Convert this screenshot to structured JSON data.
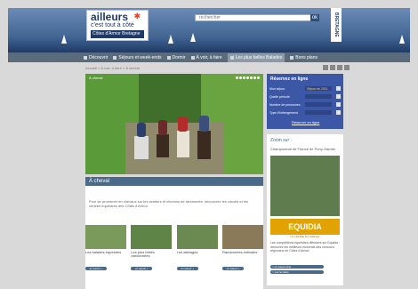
{
  "header": {
    "logo_line1": "ailleurs",
    "logo_line2": "c'est tout à côté",
    "logo_line3": "Côtes d'Armor Bretagne",
    "search_placeholder": "rechercher",
    "search_button": "ok",
    "side_label": "BRETAGNE"
  },
  "nav": {
    "items": [
      {
        "label": "Découvrir"
      },
      {
        "label": "Séjours et week-ends"
      },
      {
        "label": "Dormir"
      },
      {
        "label": "À voir, à faire"
      },
      {
        "label": "Les plus belles Balades"
      },
      {
        "label": "Bons plans"
      }
    ]
  },
  "breadcrumb": "Accueil > À voir, à faire > À cheval",
  "hero": {
    "title": "À cheval"
  },
  "section": {
    "title": "À cheval",
    "text": "Pour se promener en chevaux sur les sentiers et chemins de randonnée, découvrez les circuits et les centres équestres des Côtes d'Armor."
  },
  "thumbs": [
    {
      "caption": "Les balades équestres",
      "more": "en savoir +"
    },
    {
      "caption": "Les plus belles randonnées",
      "more": "en savoir +"
    },
    {
      "caption": "Les attelages",
      "more": "en savoir +"
    },
    {
      "caption": "Randonnées estivales",
      "more": "en savoir +"
    }
  ],
  "booking": {
    "title": "Réservez en ligne",
    "rows": [
      {
        "label": "Mon séjour",
        "value": "Séjour en 2011"
      },
      {
        "label": "Quelle période",
        "value": ""
      },
      {
        "label": "Nombre de personnes",
        "value": ""
      },
      {
        "label": "Type d'hébergement",
        "value": ""
      }
    ],
    "link": "Réserver en ligne"
  },
  "zoom": {
    "title": "Zoom sur :",
    "text": "Championnat de France de Pony-Games",
    "logo": "EQUIDIA",
    "logo_sub": "LA CHAÎNE DU CHEVAL",
    "description": "Les compétitions équestres diffusées sur Equidia : retrouvez les meilleurs moments des concours régionaux en Côtes d'Armor.",
    "btn1": "> en savoir plus",
    "btn2": "> voir la vidéo"
  },
  "colors": {
    "nav_bg": "#5a6b7c",
    "booking_bg": "#3c57a6",
    "section_title_bg": "#4a6a8a"
  }
}
